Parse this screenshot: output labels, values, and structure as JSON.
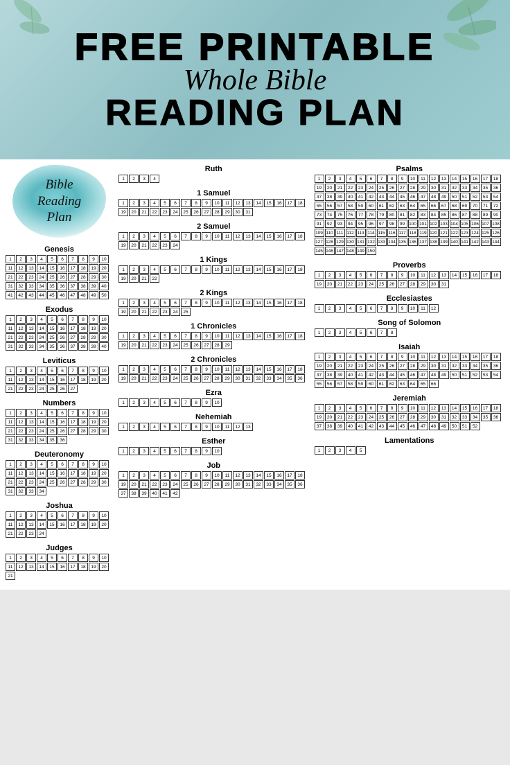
{
  "header": {
    "free_label": "FREE PRINTABLE",
    "whole_bible_label": "Whole Bible",
    "reading_plan_label": "READING PLAN"
  },
  "brp": {
    "line1": "Bible",
    "line2": "Reading",
    "line3": "Plan"
  },
  "books": {
    "left_column": [
      {
        "name": "Genesis",
        "chapters": 50
      },
      {
        "name": "Exodus",
        "chapters": 40
      },
      {
        "name": "Leviticus",
        "chapters": 27
      },
      {
        "name": "Numbers",
        "chapters": 36
      },
      {
        "name": "Deuteronomy",
        "chapters": 34
      },
      {
        "name": "Joshua",
        "chapters": 24
      },
      {
        "name": "Judges",
        "chapters": 21
      }
    ],
    "middle_column": [
      {
        "name": "Ruth",
        "chapters": 4
      },
      {
        "name": "1 Samuel",
        "chapters": 31
      },
      {
        "name": "2 Samuel",
        "chapters": 24
      },
      {
        "name": "1 Kings",
        "chapters": 22
      },
      {
        "name": "2 Kings",
        "chapters": 25
      },
      {
        "name": "1 Chronicles",
        "chapters": 29
      },
      {
        "name": "2 Chronicles",
        "chapters": 36
      },
      {
        "name": "Ezra",
        "chapters": 10
      },
      {
        "name": "Nehemiah",
        "chapters": 13
      },
      {
        "name": "Esther",
        "chapters": 10
      },
      {
        "name": "Job",
        "chapters": 42
      }
    ],
    "right_column": [
      {
        "name": "Psalms",
        "chapters": 150
      },
      {
        "name": "Proverbs",
        "chapters": 31
      },
      {
        "name": "Ecclesiastes",
        "chapters": 12
      },
      {
        "name": "Song of Solomon",
        "chapters": 8
      },
      {
        "name": "Isaiah",
        "chapters": 66
      },
      {
        "name": "Jeremiah",
        "chapters": 52
      },
      {
        "name": "Lamentations",
        "chapters": 5
      }
    ]
  }
}
